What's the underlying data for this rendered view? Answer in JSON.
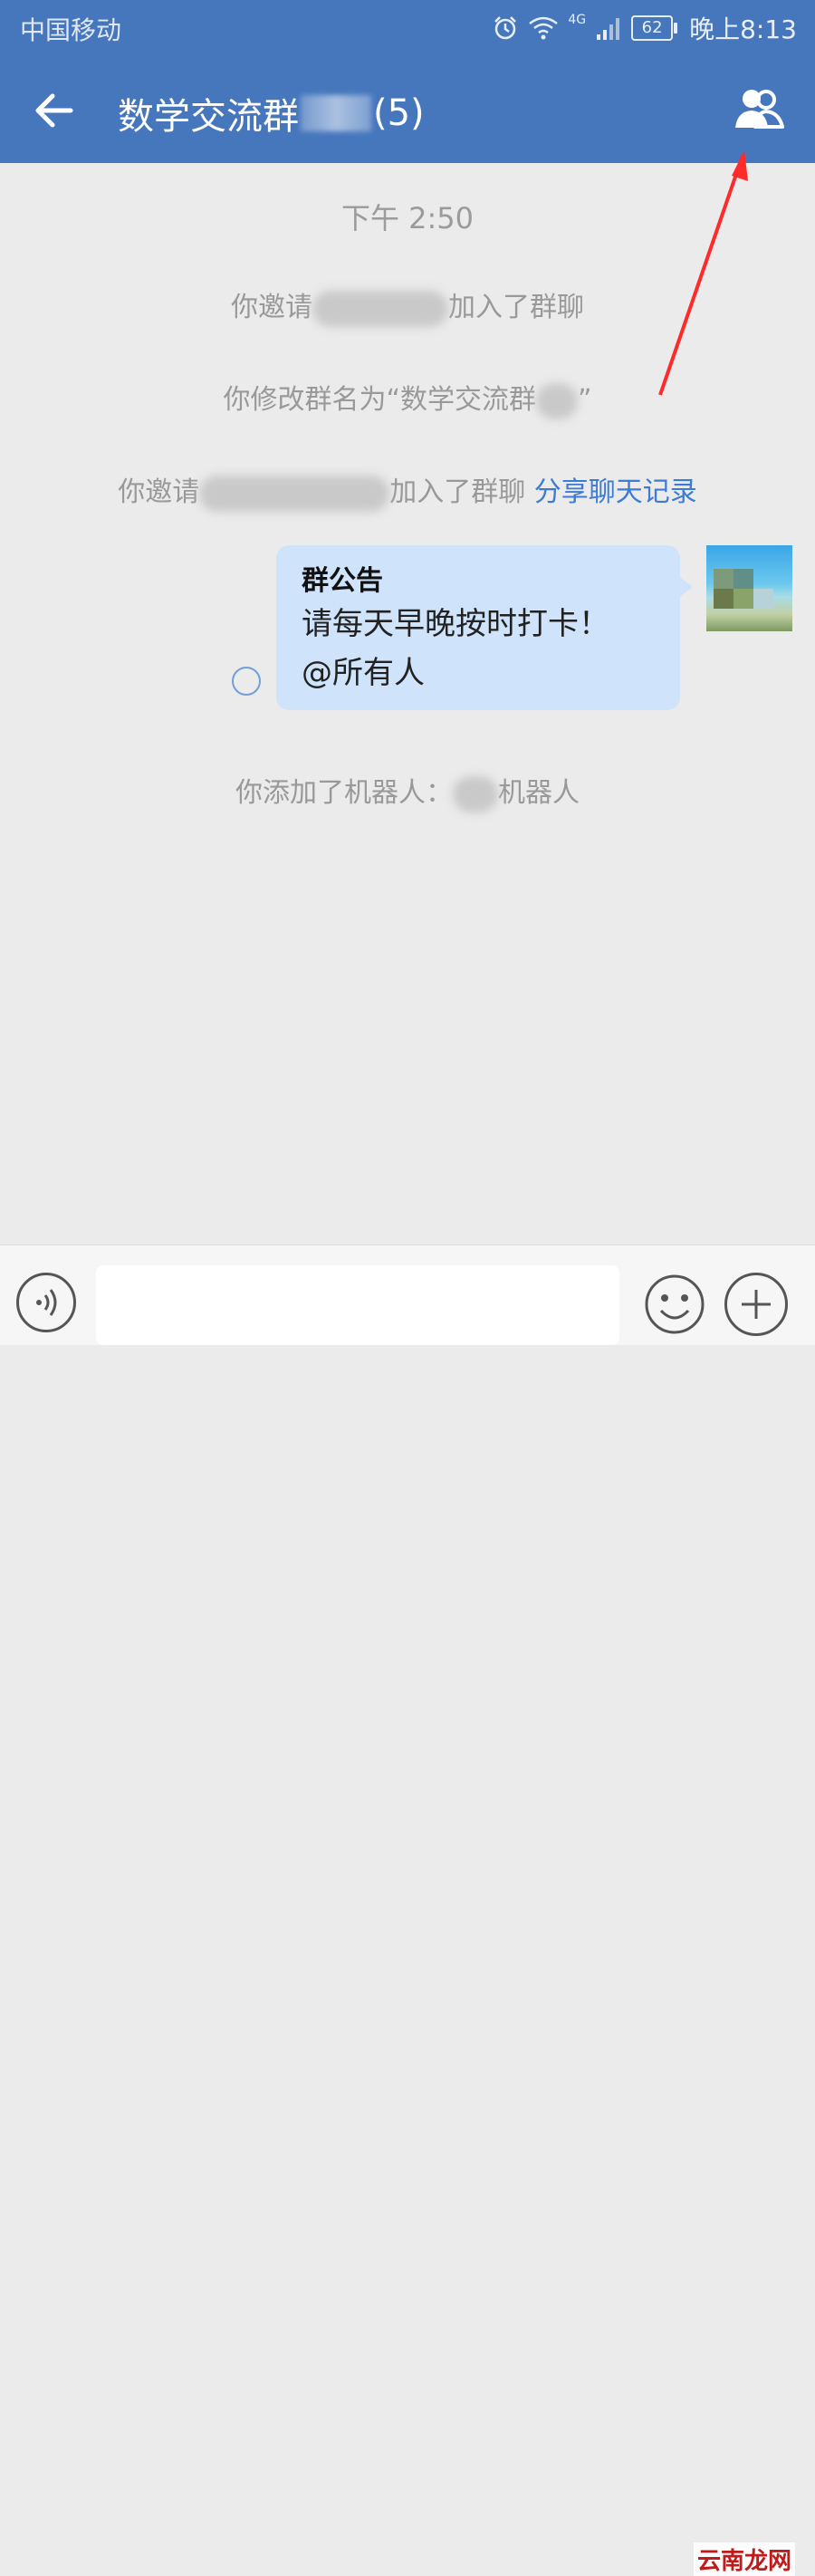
{
  "status_bar": {
    "carrier": "中国移动",
    "network": "4G",
    "battery": "62",
    "time": "晚上8:13"
  },
  "header": {
    "title": "数学交流群",
    "member_count": "(5)"
  },
  "chat": {
    "timestamp": "下午 2:50",
    "events": [
      {
        "before": "你邀请",
        "after": "加入了群聊"
      },
      {
        "before": "你修改群名为“数学交流群",
        "after": "”"
      },
      {
        "before": "你邀请",
        "after": "加入了群聊",
        "link": "分享聊天记录"
      },
      {
        "before": "你添加了机器人：",
        "after": "机器人"
      }
    ],
    "announcement": {
      "title": "群公告",
      "line1": "请每天早晚按时打卡！",
      "line2": "@所有人"
    }
  },
  "input": {
    "placeholder": ""
  },
  "watermark": "云南龙网",
  "colors": {
    "header": "#4677bd",
    "bubble": "#cfe4fb",
    "link": "#3c7bd6",
    "annotation_arrow": "#ff2a2a"
  }
}
